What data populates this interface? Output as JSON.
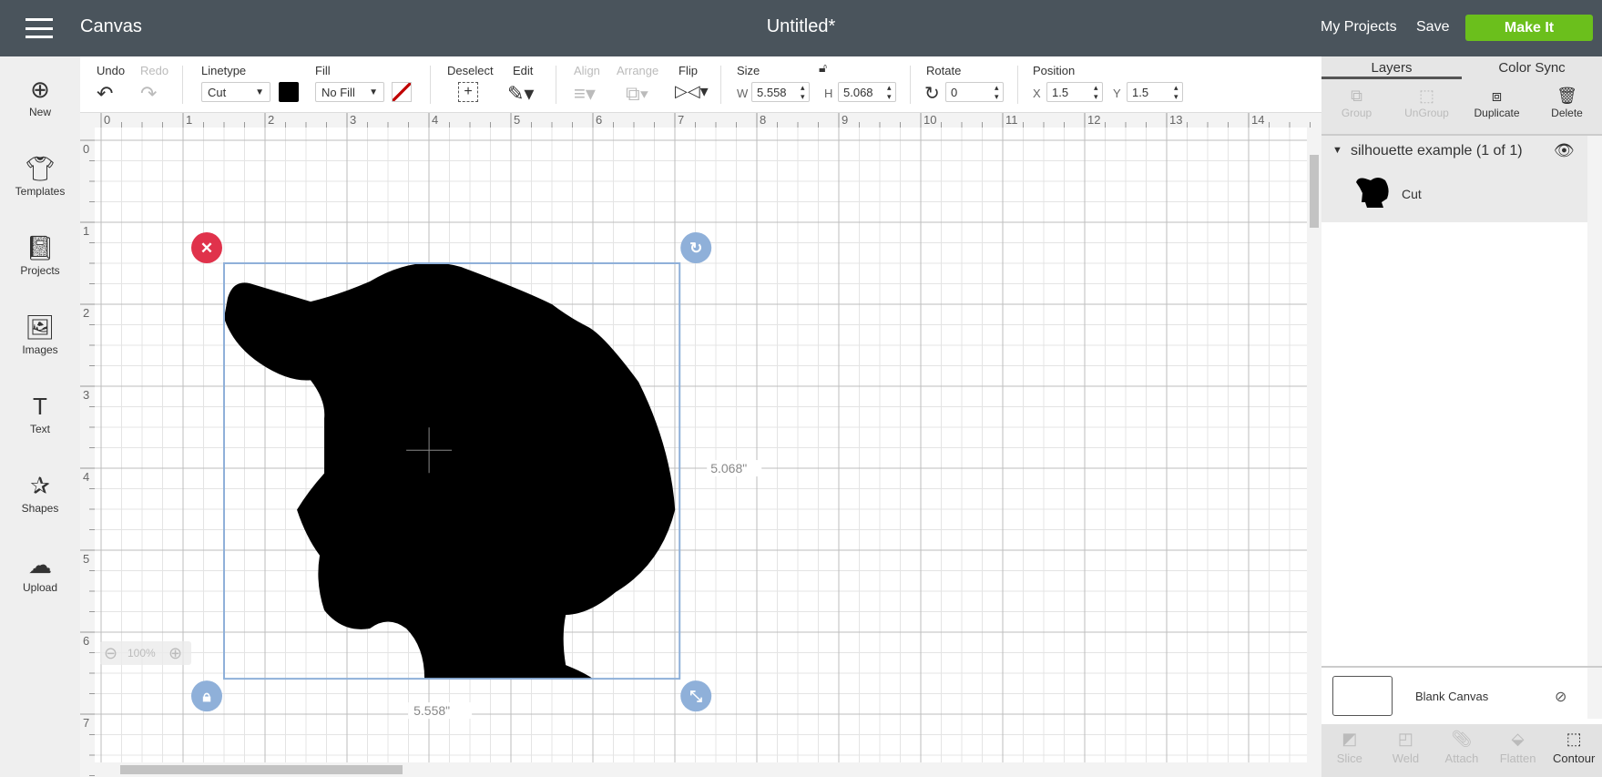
{
  "header": {
    "app": "Canvas",
    "title": "Untitled*",
    "my_projects": "My Projects",
    "save": "Save",
    "make_it": "Make It"
  },
  "toolbar": {
    "undo": "Undo",
    "redo": "Redo",
    "linetype_label": "Linetype",
    "linetype_value": "Cut",
    "fill_label": "Fill",
    "fill_value": "No Fill",
    "deselect": "Deselect",
    "edit": "Edit",
    "align": "Align",
    "arrange": "Arrange",
    "flip": "Flip",
    "size_label": "Size",
    "w_label": "W",
    "w_value": "5.558",
    "h_label": "H",
    "h_value": "5.068",
    "rotate_label": "Rotate",
    "rotate_value": "0",
    "position_label": "Position",
    "x_label": "X",
    "x_value": "1.5",
    "y_label": "Y",
    "y_value": "1.5",
    "linetype_color": "#000000",
    "fill_swatch_color": "#c00000"
  },
  "sidebar": {
    "items": [
      {
        "label": "New",
        "icon": "plus-circle-icon"
      },
      {
        "label": "Templates",
        "icon": "tshirt-icon"
      },
      {
        "label": "Projects",
        "icon": "notebook-icon"
      },
      {
        "label": "Images",
        "icon": "image-icon"
      },
      {
        "label": "Text",
        "icon": "text-icon"
      },
      {
        "label": "Shapes",
        "icon": "shapes-icon"
      },
      {
        "label": "Upload",
        "icon": "cloud-upload-icon"
      }
    ]
  },
  "panel": {
    "tabs": [
      "Layers",
      "Color Sync"
    ],
    "tools": [
      "Group",
      "UnGroup",
      "Duplicate",
      "Delete"
    ],
    "group_name": "silhouette example (1 of 1)",
    "layer_label": "Cut",
    "blank_canvas": "Blank Canvas",
    "bottom_tools": [
      "Slice",
      "Weld",
      "Attach",
      "Flatten",
      "Contour"
    ]
  },
  "canvas": {
    "ruler_x": [
      "0",
      "1",
      "2",
      "3",
      "4",
      "5",
      "6",
      "7",
      "8",
      "9",
      "10",
      "11",
      "12",
      "13",
      "14"
    ],
    "ruler_y": [
      "0",
      "1",
      "2",
      "3",
      "4",
      "5",
      "6",
      "7"
    ],
    "width_dim": "5.558\"",
    "height_dim": "5.068\"",
    "zoom": "100%",
    "accent": "#8fb0d9",
    "delete_color": "#e0324b"
  }
}
